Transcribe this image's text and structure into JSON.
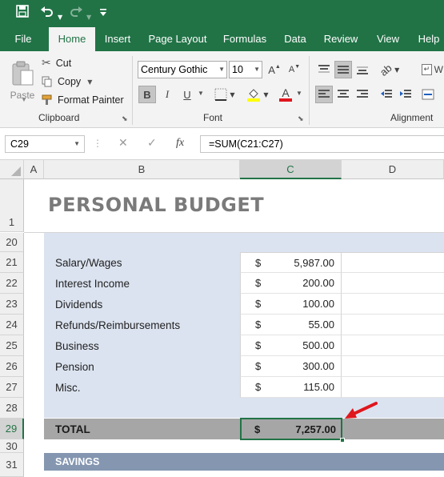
{
  "qat": {
    "save_icon": "save-icon",
    "undo_icon": "undo-icon",
    "redo_icon": "redo-icon",
    "customize_icon": "customize-icon"
  },
  "tabs": [
    {
      "label": "File"
    },
    {
      "label": "Home"
    },
    {
      "label": "Insert"
    },
    {
      "label": "Page Layout"
    },
    {
      "label": "Formulas"
    },
    {
      "label": "Data"
    },
    {
      "label": "Review"
    },
    {
      "label": "View"
    },
    {
      "label": "Help"
    }
  ],
  "clipboard": {
    "paste": "Paste",
    "cut": "Cut",
    "copy": "Copy",
    "format_painter": "Format Painter",
    "group": "Clipboard"
  },
  "font": {
    "name": "Century Gothic",
    "size": "10",
    "bold": "B",
    "italic": "I",
    "underline": "U",
    "grow": "A",
    "shrink": "A",
    "fontcolor": "A",
    "group": "Font"
  },
  "alignment": {
    "group": "Alignment",
    "wrap": "W"
  },
  "formula_bar": {
    "name_box": "C29",
    "formula": "=SUM(C21:C27)",
    "fx": "fx",
    "cancel": "✕",
    "enter": "✓"
  },
  "columns": [
    "A",
    "B",
    "C",
    "D"
  ],
  "title": "PERSONAL BUDGET",
  "rows": [
    {
      "num": "1"
    },
    {
      "num": "20"
    },
    {
      "num": "21",
      "label": "Salary/Wages",
      "cur": "$",
      "value": "5,987.00"
    },
    {
      "num": "22",
      "label": "Interest Income",
      "cur": "$",
      "value": "200.00"
    },
    {
      "num": "23",
      "label": "Dividends",
      "cur": "$",
      "value": "100.00"
    },
    {
      "num": "24",
      "label": "Refunds/Reimbursements",
      "cur": "$",
      "value": "55.00"
    },
    {
      "num": "25",
      "label": "Business",
      "cur": "$",
      "value": "500.00"
    },
    {
      "num": "26",
      "label": "Pension",
      "cur": "$",
      "value": "300.00"
    },
    {
      "num": "27",
      "label": "Misc.",
      "cur": "$",
      "value": "115.00"
    },
    {
      "num": "28"
    },
    {
      "num": "29",
      "label": "TOTAL",
      "cur": "$",
      "value": "7,257.00"
    },
    {
      "num": "30"
    },
    {
      "num": "31",
      "label": "SAVINGS"
    }
  ],
  "colors": {
    "excel_green": "#217346",
    "band_blue": "#dbe3f0",
    "total_gray": "#a6a6a6",
    "savings_blue": "#8496b0",
    "arrow_red": "#e0161d"
  }
}
